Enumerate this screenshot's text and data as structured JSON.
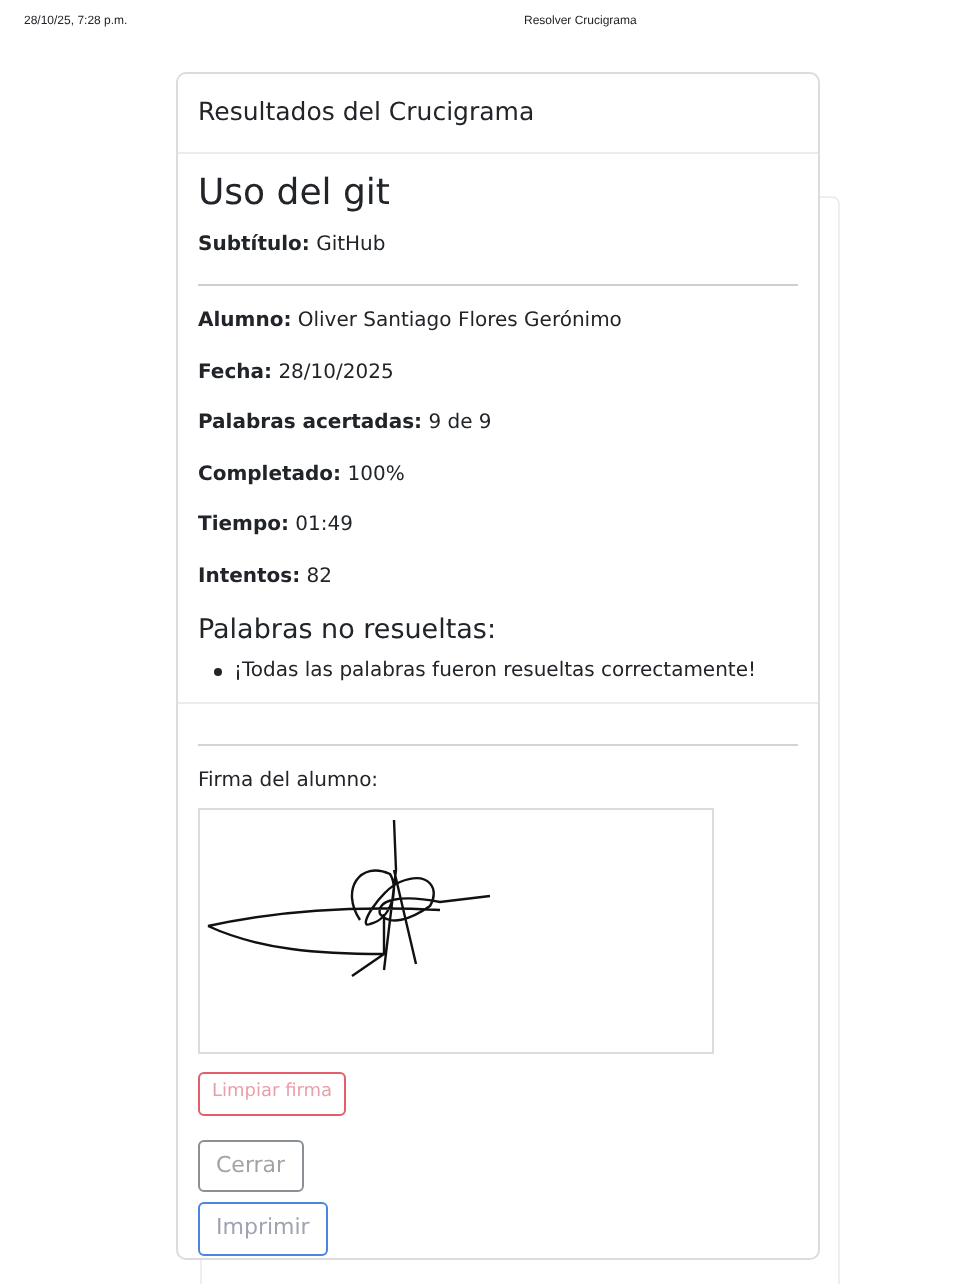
{
  "print_header": {
    "date": "28/10/25, 7:28 p.m.",
    "title": "Resolver Crucigrama"
  },
  "card": {
    "header": "Resultados del Crucigrama",
    "title": "Uso del git",
    "subtitle": "**Subtítulo:** GitHub",
    "fields": [
      "**Alumno:** Oliver Santiago Flores Gerónimo",
      "**Fecha:** 28/10/2025",
      "**Palabras acertadas:** 9 de 9",
      "**Completado:** 100%",
      "**Tiempo:** 01:49",
      "**Intentos:** 82"
    ],
    "unsolved_heading": "Palabras no resueltas:",
    "unsolved": [
      "¡Todas las palabras fueron resueltas correctamente!"
    ],
    "signature_label": "Firma del alumno:",
    "buttons": [
      {
        "label": "Limpiar firma",
        "kind": "danger"
      },
      {
        "label": "Cerrar",
        "kind": "secondary"
      },
      {
        "label": "Imprimir",
        "kind": "primary"
      }
    ]
  }
}
